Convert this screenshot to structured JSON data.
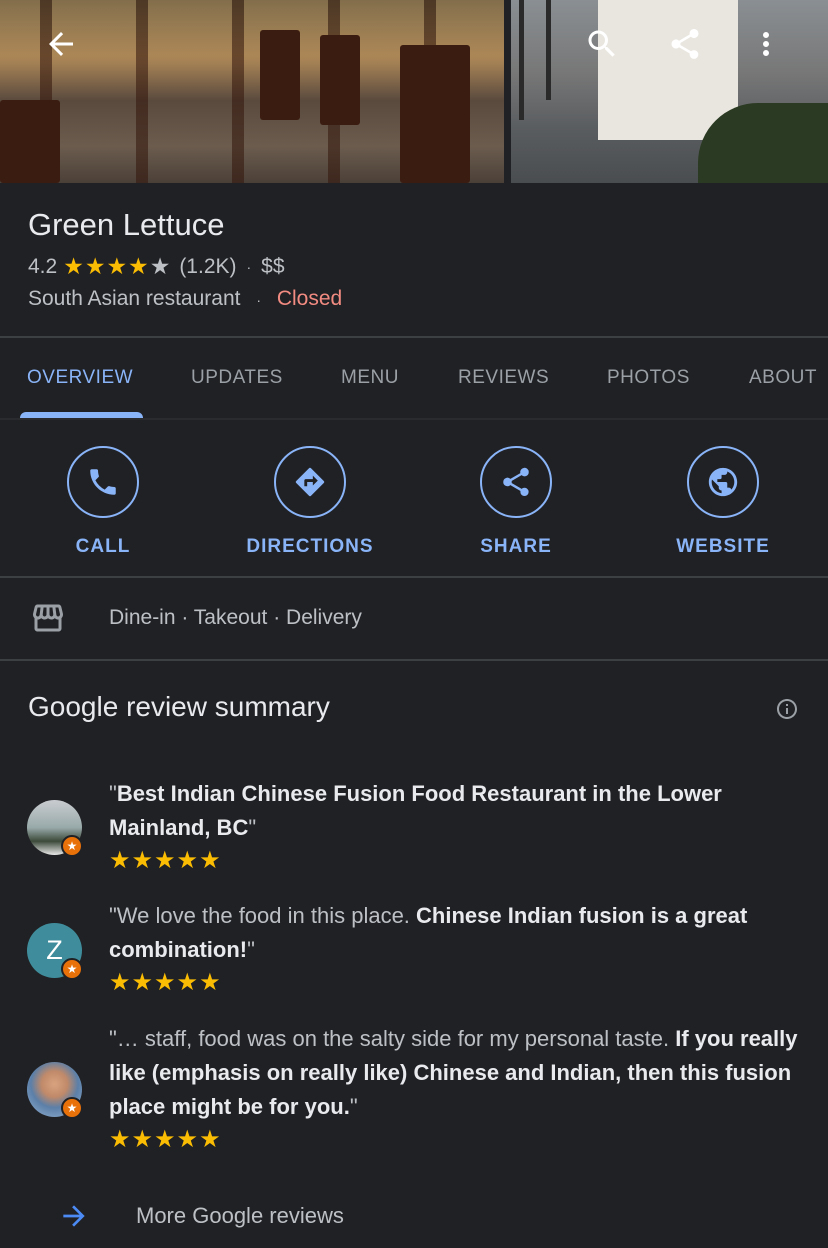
{
  "place": {
    "name": "Green Lettuce",
    "rating": "4.2",
    "stars": "★★★★",
    "star_empty": "★",
    "review_count": "(1.2K)",
    "dot1": "·",
    "price": "$$",
    "category": "South Asian restaurant",
    "dot2": "·",
    "status": "Closed"
  },
  "tabs": [
    "OVERVIEW",
    "UPDATES",
    "MENU",
    "REVIEWS",
    "PHOTOS",
    "ABOUT"
  ],
  "actions": [
    {
      "label": "CALL",
      "icon": "phone-icon"
    },
    {
      "label": "DIRECTIONS",
      "icon": "directions-icon"
    },
    {
      "label": "SHARE",
      "icon": "share-icon"
    },
    {
      "label": "WEBSITE",
      "icon": "globe-icon"
    }
  ],
  "services": {
    "text": "Dine-in · Takeout · Delivery",
    "icon": "storefront-icon"
  },
  "summary": {
    "title": "Google review summary"
  },
  "reviews": [
    {
      "plain_before": "\"",
      "bold": "Best Indian Chinese Fusion Food Restaurant in the Lower Mainland, BC",
      "plain_after": "\"",
      "stars": "★★★★★"
    },
    {
      "avatar_letter": "Z",
      "plain_before": "\"We love the food in this place. ",
      "bold": "Chinese Indian fusion is a great combination!",
      "plain_after": "\"",
      "stars": "★★★★★"
    },
    {
      "plain_before": "\"… staff, food was on the salty side for my personal taste. ",
      "bold": "If you really like (emphasis on really like) Chinese and Indian, then this fusion place might be for you.",
      "plain_after": "\"",
      "stars": "★★★★★"
    }
  ],
  "more_reviews": "More Google reviews",
  "colors": {
    "background": "#202124",
    "accent": "#8ab4f8",
    "star": "#fbbc04",
    "closed": "#f28b82"
  }
}
